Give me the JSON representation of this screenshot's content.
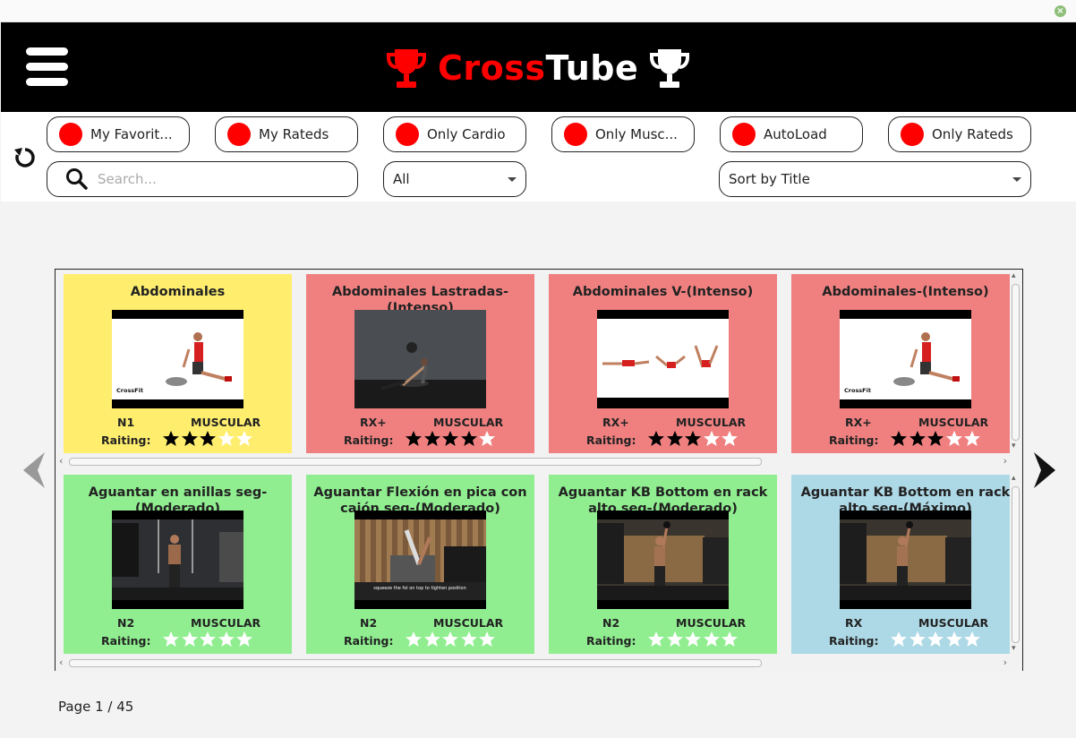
{
  "window": {
    "close_glyph": "×"
  },
  "header": {
    "menu_icon": "hamburger-icon",
    "brand_part1": "Cross",
    "brand_part2": "Tube",
    "brand_color_red": "#ff0000",
    "brand_icon": "trophy-icon"
  },
  "toolbar": {
    "toggles": [
      {
        "label": "My Favorit..."
      },
      {
        "label": "My Rateds"
      },
      {
        "label": "Only Cardio"
      },
      {
        "label": "Only Musc..."
      },
      {
        "label": "AutoLoad"
      },
      {
        "label": "Only Rateds"
      }
    ],
    "toggle_color": "#ff0000",
    "search_placeholder": "Search...",
    "level_filter": "All",
    "sort": "Sort by Title"
  },
  "rating_label": "Raiting:",
  "cards": [
    {
      "title": "Abdominales",
      "level": "N1",
      "type": "MUSCULAR",
      "rating": 3,
      "bg": "#ffee6e",
      "thumb": "woman-seated-white"
    },
    {
      "title": "Abdominales Lastradas-(Intenso)",
      "level": "RX+",
      "type": "MUSCULAR",
      "rating": 4,
      "bg": "#f08080",
      "thumb": "woman-floor-grey"
    },
    {
      "title": "Abdominales V-(Intenso)",
      "level": "RX+",
      "type": "MUSCULAR",
      "rating": 3,
      "bg": "#f08080",
      "thumb": "v-up-sequence"
    },
    {
      "title": "Abdominales-(Intenso)",
      "level": "RX+",
      "type": "MUSCULAR",
      "rating": 3,
      "bg": "#f08080",
      "thumb": "woman-seated-white"
    },
    {
      "title": "Aguantar en anillas seg-(Moderado)",
      "level": "N2",
      "type": "MUSCULAR",
      "rating": 0,
      "bg": "#90ee90",
      "thumb": "gym-rings"
    },
    {
      "title": "Aguantar Flexión en pica con cajón seg-(Moderado)",
      "level": "N2",
      "type": "MUSCULAR",
      "rating": 0,
      "bg": "#90ee90",
      "thumb": "gym-pike",
      "caption": "squeeze the fol on top to tighten position"
    },
    {
      "title": "Aguantar KB Bottom en rack alto seg-(Moderado)",
      "level": "N2",
      "type": "MUSCULAR",
      "rating": 0,
      "bg": "#90ee90",
      "thumb": "gym-kb"
    },
    {
      "title": "Aguantar KB Bottom en rack alto seg-(Máximo)",
      "level": "RX",
      "type": "MUSCULAR",
      "rating": 0,
      "bg": "#add8e6",
      "thumb": "gym-kb"
    }
  ],
  "thumb_brand": "CrossFit",
  "pagination": {
    "label": "Page 1 / 45"
  }
}
